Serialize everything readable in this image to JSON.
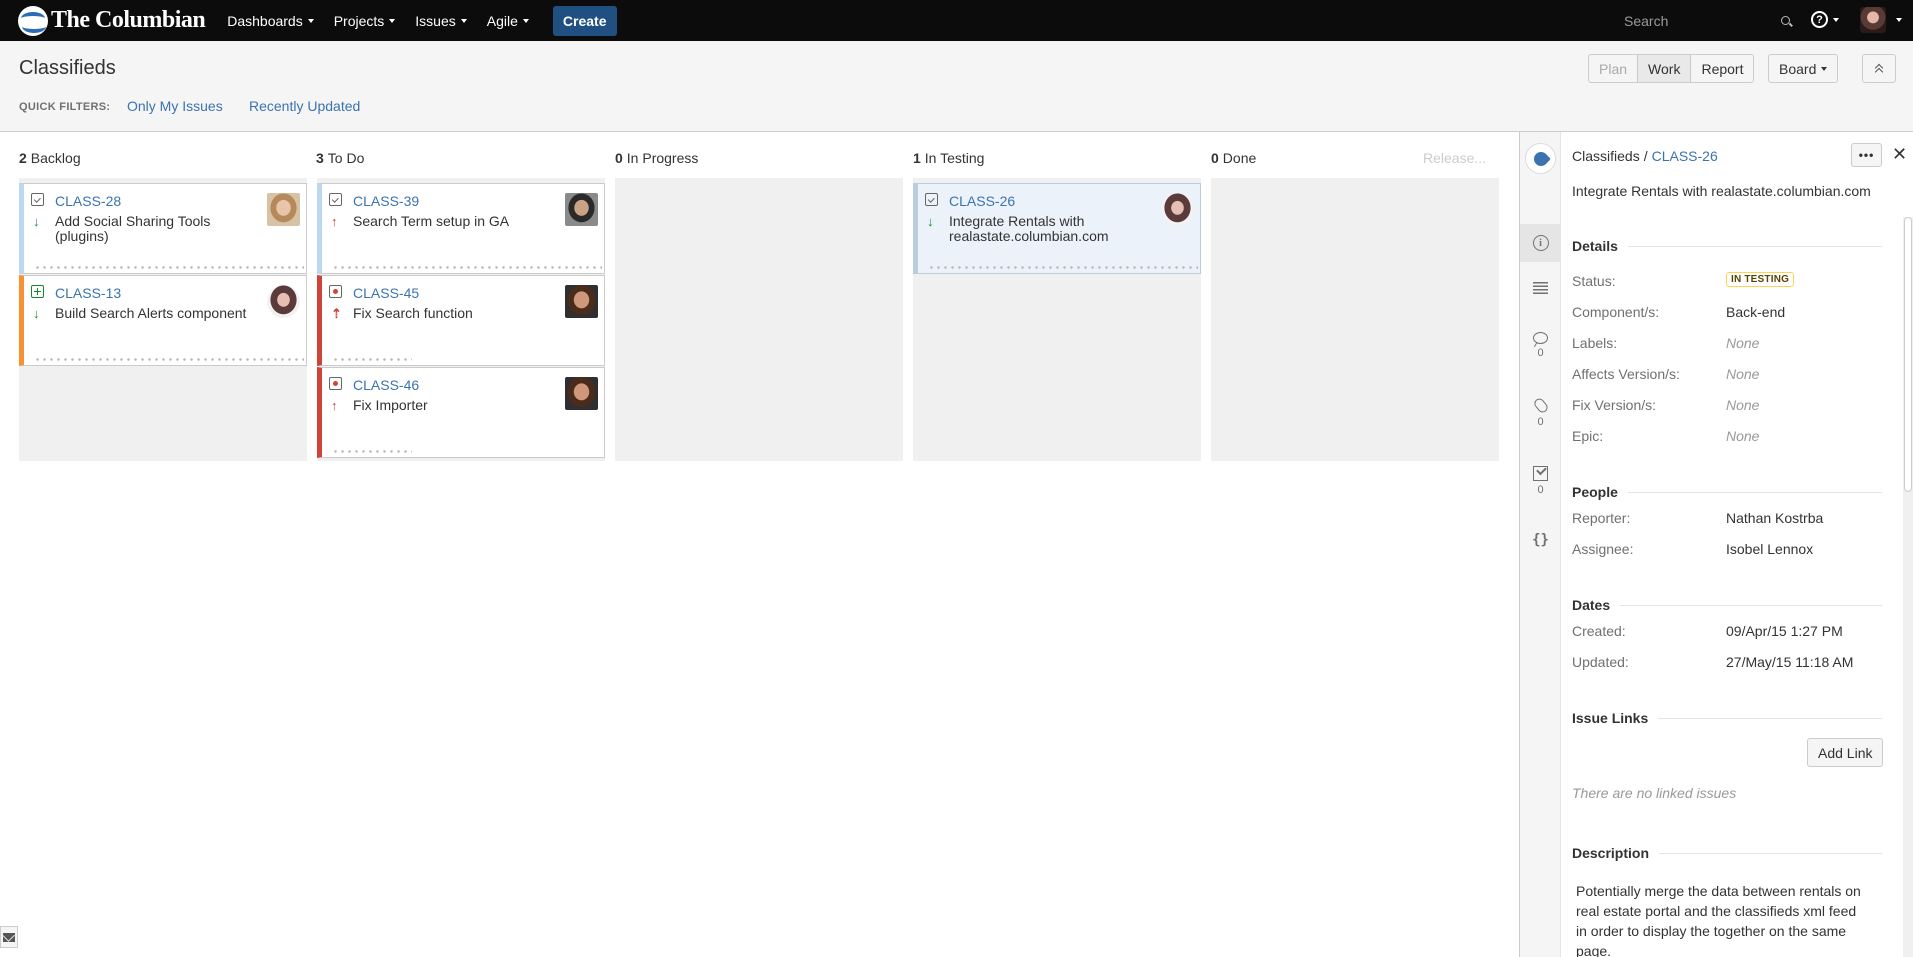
{
  "nav": {
    "brand": "The Columbian",
    "menus": [
      "Dashboards",
      "Projects",
      "Issues",
      "Agile"
    ],
    "create": "Create",
    "search_placeholder": "Search",
    "help_glyph": "?"
  },
  "header": {
    "title": "Classifieds",
    "quick_filters_label": "QUICK FILTERS:",
    "quick_filters": [
      "Only My Issues",
      "Recently Updated"
    ],
    "modes": [
      "Plan",
      "Work",
      "Report"
    ],
    "active_mode": "Work",
    "board_menu": "Board"
  },
  "columns": [
    {
      "count": "2",
      "name": "Backlog"
    },
    {
      "count": "3",
      "name": "To Do"
    },
    {
      "count": "0",
      "name": "In Progress"
    },
    {
      "count": "1",
      "name": "In Testing"
    },
    {
      "count": "0",
      "name": "Done"
    }
  ],
  "release_link": "Release...",
  "cards": [
    {
      "key": "CLASS-28",
      "summary": "Add Social Sharing Tools (plugins)",
      "type": "task-icon",
      "priority": "low-priority-icon",
      "accent": "#bcd7f0"
    },
    {
      "key": "CLASS-13",
      "summary": "Build Search Alerts component",
      "type": "new-feature-icon",
      "priority": "low-priority-icon",
      "accent": "#f79232"
    },
    {
      "key": "CLASS-39",
      "summary": "Search Term setup in GA",
      "type": "task-icon",
      "priority": "high-priority-icon",
      "accent": "#bcd7f0"
    },
    {
      "key": "CLASS-45",
      "summary": "Fix Search function",
      "type": "bug-icon",
      "priority": "blocker-priority-icon",
      "accent": "#d04437"
    },
    {
      "key": "CLASS-46",
      "summary": "Fix Importer",
      "type": "bug-icon",
      "priority": "high-priority-icon",
      "accent": "#d04437"
    },
    {
      "key": "CLASS-26",
      "summary": "Integrate Rentals with realastate.columbian.com",
      "type": "task-icon",
      "priority": "low-priority-icon",
      "accent": "#bcd7f0"
    }
  ],
  "detail": {
    "project": "Classifieds",
    "separator": "/",
    "key": "CLASS-26",
    "summary": "Integrate Rentals with realastate.columbian.com",
    "more": "•••",
    "close": "✕",
    "rail_counts": {
      "comments": "0",
      "attachments": "0",
      "subtasks": "0"
    },
    "rail_braces": "{}",
    "details_title": "Details",
    "status_label": "Status:",
    "status_value": "IN TESTING",
    "component_label": "Component/s:",
    "component_value": "Back-end",
    "labels_label": "Labels:",
    "labels_value": "None",
    "affects_label": "Affects Version/s:",
    "affects_value": "None",
    "fix_label": "Fix Version/s:",
    "fix_value": "None",
    "epic_label": "Epic:",
    "epic_value": "None",
    "people_title": "People",
    "reporter_label": "Reporter:",
    "reporter_value": "Nathan Kostrba",
    "assignee_label": "Assignee:",
    "assignee_value": "Isobel Lennox",
    "dates_title": "Dates",
    "created_label": "Created:",
    "created_value": "09/Apr/15 1:27 PM",
    "updated_label": "Updated:",
    "updated_value": "27/May/15 11:18 AM",
    "links_title": "Issue Links",
    "add_link": "Add Link",
    "no_links": "There are no linked issues",
    "description_title": "Description",
    "description": "Potentially merge the data between rentals on real estate portal and the classifieds xml feed in order to display the together on the same page."
  },
  "colors": {
    "topbar": "#0c0c0c",
    "create_button": "#205081",
    "link": "#3b73af",
    "selected_card": "#ebf2f9"
  }
}
